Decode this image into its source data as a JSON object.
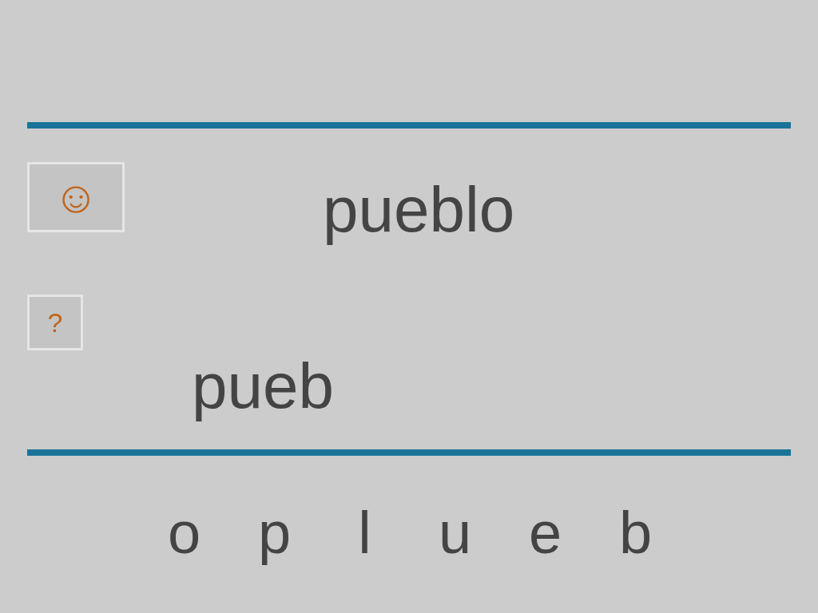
{
  "target_word": "pueblo",
  "hint_button": {
    "label": "☺"
  },
  "help_button": {
    "label": "?"
  },
  "answer": "pueb",
  "letters": [
    "o",
    "p",
    "l",
    "u",
    "e",
    "b"
  ]
}
